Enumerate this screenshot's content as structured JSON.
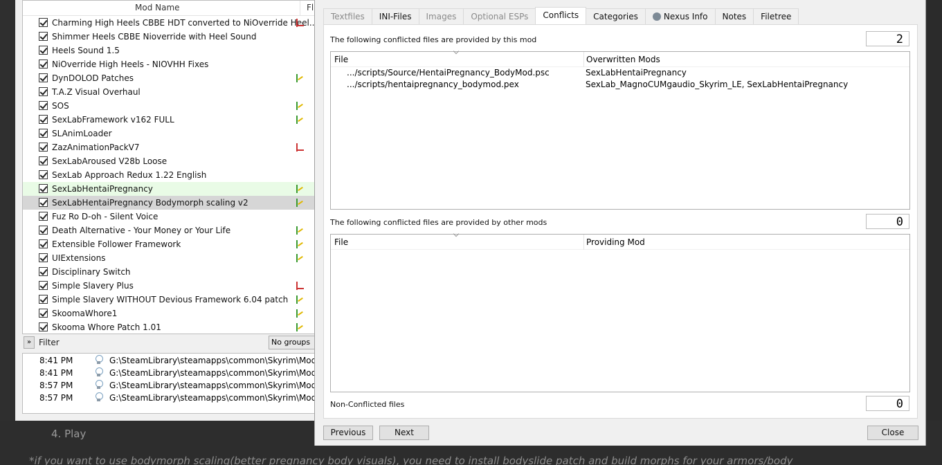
{
  "mod_list": {
    "col_name": "Mod Name",
    "col_flags": "Fl",
    "rows": [
      {
        "name": "Charming High Heels CBBE HDT converted to NiOverride Heel...",
        "flag": "red",
        "state": ""
      },
      {
        "name": "Shimmer Heels CBBE Nioverride with Heel Sound",
        "flag": "",
        "state": ""
      },
      {
        "name": "Heels Sound 1.5",
        "flag": "",
        "state": ""
      },
      {
        "name": "NiOverride High Heels - NIOVHH Fixes",
        "flag": "",
        "state": ""
      },
      {
        "name": "DynDOLOD Patches",
        "flag": "green",
        "state": ""
      },
      {
        "name": "T.A.Z Visual Overhaul",
        "flag": "",
        "state": ""
      },
      {
        "name": "SOS",
        "flag": "green",
        "state": ""
      },
      {
        "name": "SexLabFramework v162 FULL",
        "flag": "green",
        "state": ""
      },
      {
        "name": "SLAnimLoader",
        "flag": "",
        "state": ""
      },
      {
        "name": "ZazAnimationPackV7",
        "flag": "red",
        "state": ""
      },
      {
        "name": "SexLabAroused V28b Loose",
        "flag": "",
        "state": ""
      },
      {
        "name": "SexLab Approach Redux 1.22 English",
        "flag": "",
        "state": ""
      },
      {
        "name": "SexLabHentaiPregnancy",
        "flag": "green",
        "state": "green"
      },
      {
        "name": "SexLabHentaiPregnancy Bodymorph scaling v2",
        "flag": "green",
        "state": "sel"
      },
      {
        "name": "Fuz Ro D-oh - Silent Voice",
        "flag": "",
        "state": ""
      },
      {
        "name": "Death Alternative - Your Money or Your Life",
        "flag": "green",
        "state": ""
      },
      {
        "name": "Extensible Follower Framework",
        "flag": "green",
        "state": ""
      },
      {
        "name": "UIExtensions",
        "flag": "green",
        "state": ""
      },
      {
        "name": "Disciplinary Switch",
        "flag": "",
        "state": ""
      },
      {
        "name": "Simple Slavery Plus",
        "flag": "red",
        "state": ""
      },
      {
        "name": "Simple Slavery WITHOUT Devious Framework 6.04 patch",
        "flag": "green",
        "state": ""
      },
      {
        "name": "SkoomaWhore1",
        "flag": "green",
        "state": ""
      },
      {
        "name": "Skooma Whore Patch 1.01",
        "flag": "green",
        "state": ""
      }
    ]
  },
  "filter": {
    "expand_label": "»",
    "label": "Filter",
    "groups_value": "No groups"
  },
  "log": [
    {
      "time": "8:41 PM",
      "path": "G:\\SteamLibrary\\steamapps\\common\\Skyrim\\ModOrga"
    },
    {
      "time": "8:41 PM",
      "path": "G:\\SteamLibrary\\steamapps\\common\\Skyrim\\ModOrga"
    },
    {
      "time": "8:57 PM",
      "path": "G:\\SteamLibrary\\steamapps\\common\\Skyrim\\ModOrga"
    },
    {
      "time": "8:57 PM",
      "path": "G:\\SteamLibrary\\steamapps\\common\\Skyrim\\ModOrga"
    }
  ],
  "dialog": {
    "tabs": [
      {
        "label": "Textfiles",
        "state": "disabled"
      },
      {
        "label": "INI-Files",
        "state": ""
      },
      {
        "label": "Images",
        "state": "disabled"
      },
      {
        "label": "Optional ESPs",
        "state": "disabled"
      },
      {
        "label": "Conflicts",
        "state": "active"
      },
      {
        "label": "Categories",
        "state": ""
      },
      {
        "label": "Nexus Info",
        "state": "",
        "icon": "nexus-globe-icon"
      },
      {
        "label": "Notes",
        "state": ""
      },
      {
        "label": "Filetree",
        "state": ""
      }
    ],
    "overwrite": {
      "label": "The following conflicted files are provided by this mod",
      "count": "2",
      "col_file": "File",
      "col_mods": "Overwritten Mods",
      "rows": [
        {
          "file": ".../scripts/Source/HentaiPregnancy_BodyMod.psc",
          "mods": "SexLabHentaiPregnancy"
        },
        {
          "file": ".../scripts/hentaipregnancy_bodymod.pex",
          "mods": "SexLab_MagnoCUMgaudio_Skyrim_LE, SexLabHentaiPregnancy"
        }
      ]
    },
    "overwritten": {
      "label": "The following conflicted files are provided by other mods",
      "count": "0",
      "col_file": "File",
      "col_mod": "Providing Mod"
    },
    "non_conflicted": {
      "label": "Non-Conflicted files",
      "count": "0"
    },
    "buttons": {
      "previous": "Previous",
      "next": "Next",
      "close": "Close"
    }
  },
  "web": {
    "step": "4. Play",
    "note": "*if you want to use bodymorph scaling(better pregnancy body visuals), you need to install bodyslide patch and build morphs for your armors/body"
  }
}
